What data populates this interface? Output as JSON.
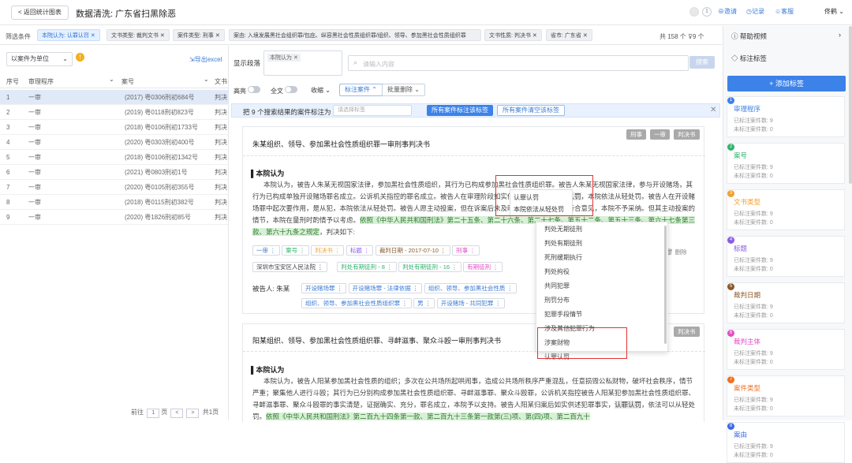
{
  "header": {
    "back": "返回统计图表",
    "title": "数据清洗: 广东省扫黑除恶",
    "count": "1",
    "invite": "邀请",
    "record": "记录",
    "service": "客服",
    "user": "佟鹤"
  },
  "filters": {
    "label": "筛选条件",
    "tags": [
      "本院认为: 认罪认罚",
      "文书类型: 裁判文书",
      "案件类型: 刑事",
      "案由: 入境发展黑社会组织罪/包庇、纵容黑社会性质组织罪/组织、领导、参加黑社会性质组织罪",
      "文书性质: 判决书",
      "省市: 广东省"
    ],
    "total": "共 158 个",
    "hidden": "9 个"
  },
  "left": {
    "unit": "以案件为单位",
    "export": "导出excel",
    "cols": [
      "序号",
      "审理程序",
      "案号",
      "文书"
    ],
    "rows": [
      [
        "1",
        "一审",
        "(2017) 粤0306刑初684号",
        "判决"
      ],
      [
        "2",
        "一审",
        "(2019) 粤0118刑初823号",
        "判决"
      ],
      [
        "3",
        "一审",
        "(2018) 粤0106刑初1733号",
        "判决"
      ],
      [
        "4",
        "一审",
        "(2020) 粤0303刑初400号",
        "判决"
      ],
      [
        "5",
        "一审",
        "(2018) 粤0106刑初1342号",
        "判决"
      ],
      [
        "6",
        "一审",
        "(2021) 粤0803刑初1号",
        "判决"
      ],
      [
        "7",
        "一审",
        "(2020) 粤0105刑初355号",
        "判决"
      ],
      [
        "8",
        "一审",
        "(2018) 粤0115刑初382号",
        "判决"
      ],
      [
        "9",
        "一审",
        "(2020) 粤1826刑初85号",
        "判决"
      ]
    ],
    "pager": {
      "goto": "前往",
      "page": "1",
      "unit": "页",
      "total": "共1页"
    }
  },
  "mid": {
    "show_label": "显示段落",
    "section_tag": "本院认为",
    "search_placeholder": "请输入内容",
    "search_btn": "搜索",
    "toggles": [
      "高亮",
      "全文"
    ],
    "collapse": "收缩",
    "tag_case": "标注案件",
    "batch_delete": "批量删除",
    "banner": {
      "text": "把 9 个搜索结果的案件标注为",
      "placeholder": "请选择标签",
      "btn1": "所有案件标注该标签",
      "btn2": "所有案件清空该标签"
    },
    "card1": {
      "title": "朱某组织、领导、参加黑社会性质组织罪一审刑事判决书",
      "badges": [
        "刑事",
        "一审",
        "判决书"
      ],
      "section": "本院认为",
      "para": "本院认为，被告人朱某无视国家法律，参加黑社会性质组织，其行为已构成参加黑社会性质组织罪。被告人朱某无视国家法律，参与开设赌场，其行为已构成单独开设赌场罪名成立。公诉机关指控的罪名成立。被告人在审理阶段如实供述犯罪事实，",
      "hl1": "认罪认罚",
      "para2": "，本院依法从轻处罚。被告人在开设赌场罪中起次要作用，是从犯",
      "hl2": "从犯",
      "para3": "，本院依法从轻处罚。被告人愿主动投案，但在诉案后未及时供述犯罪事实，不符合",
      "para4": "意见，本院不予采纳。但其主动投案的情节，本院在量刑时酌情予以考虑。",
      "law": "依照《中华人民共和国刑法》第二十五条、第二十六条、第二十七条、第五十二条、第五十三条、第六十七条第三款、第六十九条之规定",
      "tail": "，判决如下:",
      "chips1": [
        "一审",
        "案号",
        "判决书",
        "标题",
        "裁判日期 - 2017-07-10",
        "刑事"
      ],
      "court": "深圳市宝安区人民法院",
      "chips1b": [
        "判处有期徒刑 - 8",
        "判处有期徒刑 - 16",
        "有期徒刑"
      ],
      "defendant_label": "被告人: 朱某",
      "chips2": [
        "开设赌场罪",
        "开设赌场罪 - 法律依据",
        "组织、领导、参加黑社会性质"
      ],
      "chips3": [
        "组织、领导、参加黑社会性质组织罪",
        "男",
        "开设赌场 - 共同犯罪"
      ],
      "delete": "删除"
    },
    "card2": {
      "title": "阳某组织、领导、参加黑社会性质组织罪、寻衅滋事、聚众斗殴一审刑事判决书",
      "badge": "判决书",
      "section": "本院认为",
      "para": "本院认为，被告人阳某参加黑社会性质的组织；多次在公共场所起哄闹事，造成公共场所秩序严重混乱，任意损毁公私财物，破坏社会秩序，情节严重；聚集他人进行斗殴；其行为已分别构成参加黑社会性质组织罪、寻衅滋事罪、聚众斗殴罪，公诉机关指控被告人阳某犯参加黑社会性质组织罪、寻衅滋事罪、聚众斗殴罪的事实清楚，证据确实、充分，罪名成立，本院予以支持。被告人阳某归案后如实供述犯罪事实，",
      "hl": "认罪认罚",
      "para2": "，依法可以从轻处罚。",
      "law": "依照《中华人民共和国刑法》第二百九十四条第一款、第二百九十三条第一款第(三)项、第(四)项、第二百九十"
    }
  },
  "dropdown": {
    "items": [
      "判处无期徒刑",
      "判处有期徒刑",
      "死刑缓期执行",
      "判处拘役",
      "共同犯罪",
      "刑罚分布",
      "犯罪手段情节",
      "涉及其他犯罪行为",
      "涉案财物",
      "认罪认罚"
    ],
    "popup_items": [
      "认罪认罚",
      "本院依法从轻处罚"
    ]
  },
  "right": {
    "help": "帮助视频",
    "tag_label": "标注标签",
    "add": "+ 添加标签",
    "tags": [
      {
        "n": "1",
        "name": "审理程序",
        "color": "#3c82e8",
        "a": "已标注案件数: 9",
        "b": "未标注案件数: 0"
      },
      {
        "n": "2",
        "name": "案号",
        "color": "#2fb36b",
        "a": "已标注案件数: 9",
        "b": "未标注案件数: 0"
      },
      {
        "n": "3",
        "name": "文书类型",
        "color": "#f0a030",
        "a": "已标注案件数: 9",
        "b": "未标注案件数: 0"
      },
      {
        "n": "4",
        "name": "标题",
        "color": "#8a5be6",
        "a": "已标注案件数: 9",
        "b": "未标注案件数: 0"
      },
      {
        "n": "5",
        "name": "裁判日期",
        "color": "#8a5a2a",
        "a": "已标注案件数: 9",
        "b": "未标注案件数: 0"
      },
      {
        "n": "6",
        "name": "裁判主体",
        "color": "#e04ec4",
        "a": "已标注案件数: 9",
        "b": "未标注案件数: 0"
      },
      {
        "n": "7",
        "name": "案件类型",
        "color": "#f07020",
        "a": "已标注案件数: 9",
        "b": "未标注案件数: 0"
      },
      {
        "n": "8",
        "name": "案由",
        "color": "#3c6ae8",
        "a": "已标注案件数: 9",
        "b": "未标注案件数: 0"
      }
    ]
  }
}
